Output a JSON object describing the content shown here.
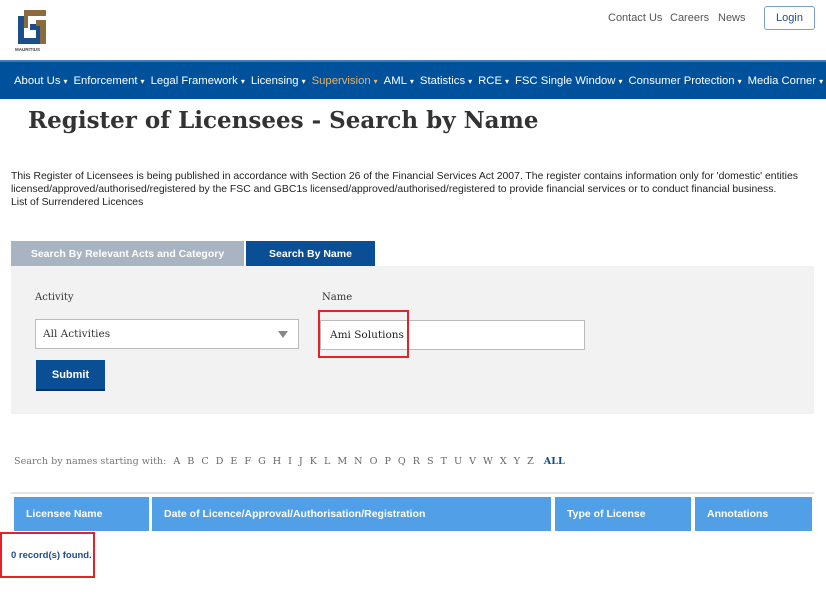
{
  "logo": {
    "text": "FSC",
    "subtext": "MAURITIUS",
    "colors": {
      "gold": "#8b6a3e",
      "blue": "#1b4f8a"
    }
  },
  "top_links": [
    "Contact Us",
    "Careers",
    "News"
  ],
  "login_label": "Login",
  "nav": {
    "items": [
      {
        "label": "About Us"
      },
      {
        "label": "Enforcement"
      },
      {
        "label": "Legal Framework"
      },
      {
        "label": "Licensing"
      },
      {
        "label": "Supervision",
        "active": true
      },
      {
        "label": "AML"
      },
      {
        "label": "Statistics"
      },
      {
        "label": "RCE"
      },
      {
        "label": "FSC Single Window"
      },
      {
        "label": "Consumer Protection"
      },
      {
        "label": "Media Corner"
      }
    ],
    "caret": "▾",
    "color": "#00519b",
    "active_color": "#e3b36a"
  },
  "page_title": "Register of Licensees - Search by Name",
  "intro": {
    "line1": "This Register of Licensees is being published in accordance with Section 26 of the Financial Services Act 2007. The register contains information only for 'domestic' entities",
    "line2": "licensed/approved/authorised/registered by the FSC and GBC1s licensed/approved/authorised/registered to provide financial services or to conduct financial business.",
    "line3": "List of Surrendered Licences"
  },
  "tabs": [
    {
      "label": "Search By Relevant Acts and Category",
      "active": false
    },
    {
      "label": "Search By Name",
      "active": true
    }
  ],
  "form": {
    "activity_label": "Activity",
    "activity_value": "All Activities",
    "name_label": "Name",
    "name_value": "Ami Solutions",
    "submit_label": "Submit"
  },
  "alpha": {
    "label": "Search by names starting with:",
    "letters": [
      "A",
      "B",
      "C",
      "D",
      "E",
      "F",
      "G",
      "H",
      "I",
      "J",
      "K",
      "L",
      "M",
      "N",
      "O",
      "P",
      "Q",
      "R",
      "S",
      "T",
      "U",
      "V",
      "W",
      "X",
      "Y",
      "Z"
    ],
    "all_label": "ALL"
  },
  "table": {
    "headers": [
      "Licensee Name",
      "Date of Licence/Approval/Authorisation/Registration",
      "Type of License",
      "Annotations"
    ],
    "rows": []
  },
  "records_text": "0 record(s) found."
}
